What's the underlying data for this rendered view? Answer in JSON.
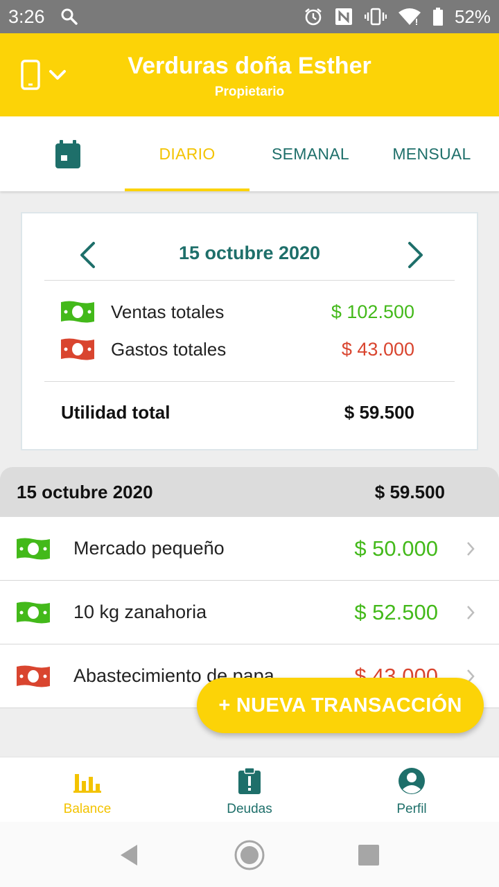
{
  "status_bar": {
    "time": "3:26",
    "battery": "52%",
    "icons": [
      "search-icon",
      "alarm-icon",
      "nfc-icon",
      "vibrate-icon",
      "wifi-icon",
      "battery-icon"
    ]
  },
  "header": {
    "title": "Verduras doña Esther",
    "subtitle": "Propietario",
    "device_icon": "phone-icon",
    "dropdown_icon": "chevron-down-icon"
  },
  "tabs": {
    "calendar_icon": "calendar-icon",
    "items": [
      {
        "label": "DIARIO",
        "active": true
      },
      {
        "label": "SEMANAL",
        "active": false
      },
      {
        "label": "MENSUAL",
        "active": false
      }
    ]
  },
  "summary": {
    "date": "15 octubre 2020",
    "sales_label": "Ventas totales",
    "sales_value": "$ 102.500",
    "expenses_label": "Gastos totales",
    "expenses_value": "$ 43.000",
    "total_label": "Utilidad total",
    "total_value": "$ 59.500"
  },
  "day_group": {
    "date": "15 octubre 2020",
    "total": "$ 59.500"
  },
  "transactions": [
    {
      "type": "income",
      "description": "Mercado pequeño",
      "amount": "$ 50.000"
    },
    {
      "type": "income",
      "description": "10 kg zanahoria",
      "amount": "$ 52.500"
    },
    {
      "type": "expense",
      "description": "Abastecimiento de papa",
      "amount": "$ 43.000"
    }
  ],
  "fab": {
    "label": "+ NUEVA TRANSACCIÓN"
  },
  "bottom_nav": [
    {
      "label": "Balance",
      "icon": "bar-chart-icon",
      "active": true
    },
    {
      "label": "Deudas",
      "icon": "clipboard-alert-icon",
      "active": false
    },
    {
      "label": "Perfil",
      "icon": "user-circle-icon",
      "active": false
    }
  ],
  "colors": {
    "brand_yellow": "#fcd307",
    "teal": "#1e6f6a",
    "income_green": "#43b91a",
    "expense_red": "#d9452f"
  }
}
